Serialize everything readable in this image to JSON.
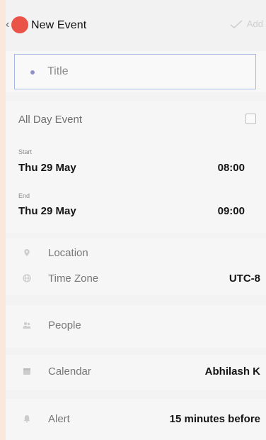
{
  "header": {
    "title": "New Event",
    "add_label": "Add",
    "back_glyph": "‹",
    "accent_color": "#ea5448"
  },
  "title_field": {
    "placeholder": "Title"
  },
  "all_day": {
    "label": "All Day Event",
    "checked": false
  },
  "start": {
    "label": "Start",
    "date": "Thu 29 May",
    "time": "08:00"
  },
  "end": {
    "label": "End",
    "date": "Thu 29 May",
    "time": "09:00"
  },
  "location": {
    "label": "Location",
    "icon": "location-pin-icon"
  },
  "time_zone": {
    "label": "Time Zone",
    "value": "UTC-8",
    "icon": "globe-icon"
  },
  "people": {
    "label": "People",
    "icon": "people-icon"
  },
  "calendar": {
    "label": "Calendar",
    "value": "Abhilash K",
    "icon": "calendar-icon"
  },
  "alert": {
    "label": "Alert",
    "value": "15 minutes before",
    "icon": "bell-icon"
  }
}
